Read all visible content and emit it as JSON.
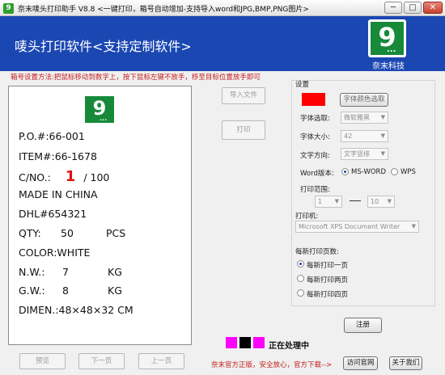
{
  "window": {
    "title": "奈末唛头打印助手 V8.8 <一键打印，箱号自动增加-支持导入word和JPG,BMP,PNG图片>",
    "min": "─",
    "max": "□",
    "close": "✕"
  },
  "banner": {
    "title": "唛头打印软件<支持定制软件>",
    "brand_name": "奈末科技",
    "brand_logo_text": "9",
    "brand_logo_dots": "..."
  },
  "instructions": "箱号设置方法:把鼠标移动到数字上，按下鼠标左键不放手，移至目标位置放手即可",
  "preview": {
    "logo_text": "9",
    "po": "P.O.#:66-001",
    "item": "ITEM#:66-1678",
    "cno_label": "C/NO.:",
    "cno_current": "1",
    "cno_total": "/ 100",
    "made_in": "MADE    IN CHINA",
    "dhl": "DHL#654321",
    "qty_label": "QTY:",
    "qty_value": "50",
    "qty_unit": "PCS",
    "color": "COLOR:WHITE",
    "nw_label": "N.W.:",
    "nw_value": "7",
    "nw_unit": "KG",
    "gw_label": "G.W.:",
    "gw_value": "8",
    "gw_unit": "KG",
    "dimen": "DIMEN.:48×48×32 CM"
  },
  "nav": {
    "preview": "预览",
    "next": "下一页",
    "prev": "上一页"
  },
  "actions": {
    "import": "导入文件",
    "print": "打印"
  },
  "settings": {
    "title": "设置",
    "swatch_color": "#ff0000",
    "font_color_button": "字体颜色选取",
    "font_select_label": "字体选取:",
    "font_select_value": "微软雅黑",
    "font_size_label": "字体大小:",
    "font_size_value": "42",
    "text_dir_label": "文字方向:",
    "text_dir_value": "文字竖排",
    "word_version_label": "Word版本:",
    "word_option_ms": "MS-WORD",
    "word_option_wps": "WPS",
    "word_selected": "MS-WORD",
    "print_range_label": "打印范围:",
    "range_from": "1",
    "range_to": "10",
    "printer_label": "打印机:",
    "printer_value": "Microsoft XPS Document Writer",
    "per_page_label": "每新打印页数:",
    "per_page_options": [
      "每新打印一页",
      "每新打印两页",
      "每新打印四页"
    ],
    "per_page_selected": "每新打印一页"
  },
  "register_button": "注册",
  "status": {
    "colors": [
      "#ff00ff",
      "#000000",
      "#ff00ff"
    ],
    "text": "正在处理中"
  },
  "footer": {
    "note": "奈末官方正版，安全放心，官方下载-->",
    "visit_site": "访问官网",
    "about": "关于我们"
  }
}
